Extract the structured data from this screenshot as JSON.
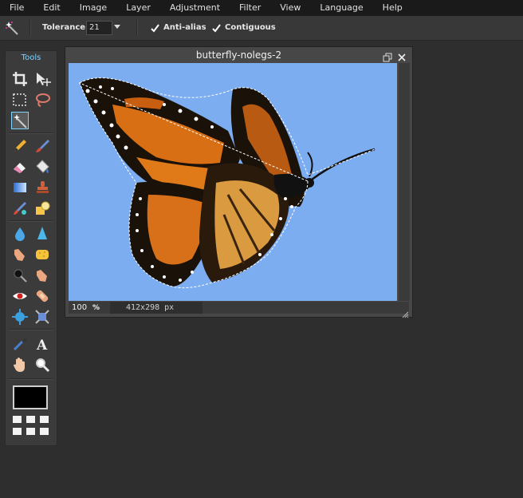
{
  "menu": [
    "File",
    "Edit",
    "Image",
    "Layer",
    "Adjustment",
    "Filter",
    "View",
    "Language",
    "Help"
  ],
  "options": {
    "tool_icon": "magic-wand-icon",
    "tolerance_label": "Tolerance:",
    "tolerance_value": "21",
    "antialias_label": "Anti-alias",
    "antialias_checked": true,
    "contiguous_label": "Contiguous",
    "contiguous_checked": true
  },
  "tools_panel": {
    "title": "Tools",
    "active_tool": "magic-wand",
    "foreground_color": "#000000"
  },
  "image_window": {
    "title": "butterfly-nolegs-2",
    "zoom": "100",
    "zoom_unit": "%",
    "dimensions": "412x298 px",
    "background_color": "#7dadf1"
  },
  "colors": {
    "accent": "#7fd4ff",
    "menubar": "#1a1a1a",
    "workspace": "#2e2e2e"
  }
}
